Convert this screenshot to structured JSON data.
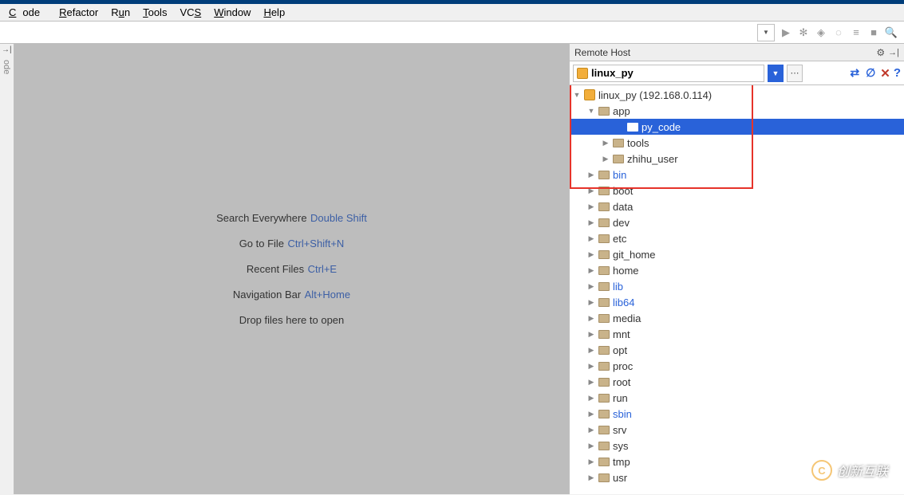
{
  "menu": {
    "items": [
      "Code",
      "Refactor",
      "Run",
      "Tools",
      "VCS",
      "Window",
      "Help"
    ]
  },
  "sidebar_text": "ode",
  "editor_hints": [
    {
      "label": "Search Everywhere",
      "kbd": "Double Shift"
    },
    {
      "label": "Go to File",
      "kbd": "Ctrl+Shift+N"
    },
    {
      "label": "Recent Files",
      "kbd": "Ctrl+E"
    },
    {
      "label": "Navigation Bar",
      "kbd": "Alt+Home"
    },
    {
      "label": "Drop files here to open",
      "kbd": ""
    }
  ],
  "remote": {
    "panel_title": "Remote Host",
    "host_name": "linux_py",
    "root": "linux_py (192.168.0.114)",
    "app": {
      "name": "app",
      "children": [
        {
          "name": "py_code",
          "selected": true
        },
        {
          "name": "tools"
        },
        {
          "name": "zhihu_user"
        }
      ]
    },
    "dirs": [
      {
        "name": "bin",
        "link": true
      },
      {
        "name": "boot"
      },
      {
        "name": "data"
      },
      {
        "name": "dev"
      },
      {
        "name": "etc"
      },
      {
        "name": "git_home"
      },
      {
        "name": "home"
      },
      {
        "name": "lib",
        "link": true
      },
      {
        "name": "lib64",
        "link": true
      },
      {
        "name": "media"
      },
      {
        "name": "mnt"
      },
      {
        "name": "opt"
      },
      {
        "name": "proc"
      },
      {
        "name": "root"
      },
      {
        "name": "run"
      },
      {
        "name": "sbin",
        "link": true
      },
      {
        "name": "srv"
      },
      {
        "name": "sys"
      },
      {
        "name": "tmp"
      },
      {
        "name": "usr"
      }
    ]
  },
  "watermark": "创新互联"
}
